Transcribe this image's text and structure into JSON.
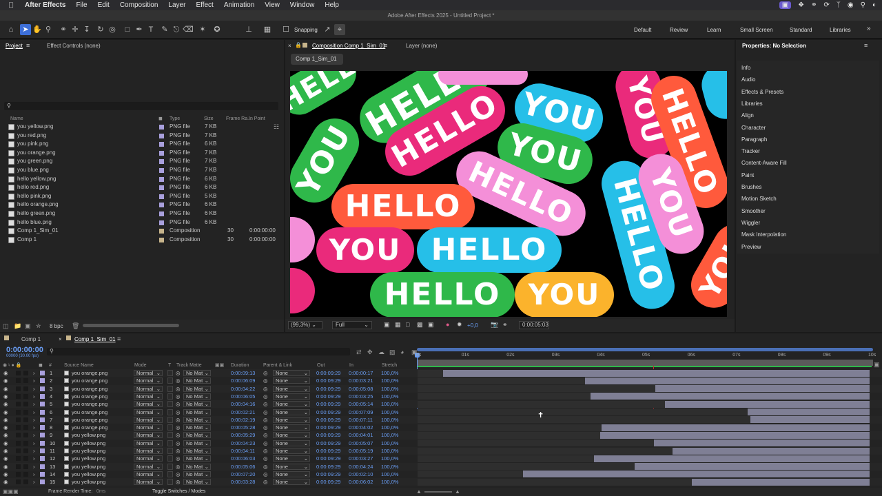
{
  "menubar": {
    "app": "After Effects",
    "items": [
      "File",
      "Edit",
      "Composition",
      "Layer",
      "Effect",
      "Animation",
      "View",
      "Window",
      "Help"
    ]
  },
  "window_title": "Adobe After Effects 2025 - Untitled Project *",
  "toolbar": {
    "snapping_label": "Snapping",
    "workspaces": [
      "Default",
      "Review",
      "Learn",
      "Small Screen",
      "Standard",
      "Libraries"
    ]
  },
  "project_panel": {
    "tab_project": "Project",
    "tab_effect_controls": "Effect Controls (none)",
    "columns": {
      "name": "Name",
      "type": "Type",
      "size": "Size",
      "frame_rate": "Frame Ra...",
      "in_point": "In Point"
    },
    "items": [
      {
        "name": "you yellow.png",
        "type": "PNG file",
        "size": "7 KB",
        "fr": "",
        "ip": ""
      },
      {
        "name": "you red.png",
        "type": "PNG file",
        "size": "7 KB",
        "fr": "",
        "ip": ""
      },
      {
        "name": "you pink.png",
        "type": "PNG file",
        "size": "6 KB",
        "fr": "",
        "ip": ""
      },
      {
        "name": "you orange.png",
        "type": "PNG file",
        "size": "7 KB",
        "fr": "",
        "ip": ""
      },
      {
        "name": "you green.png",
        "type": "PNG file",
        "size": "7 KB",
        "fr": "",
        "ip": ""
      },
      {
        "name": "you blue.png",
        "type": "PNG file",
        "size": "7 KB",
        "fr": "",
        "ip": ""
      },
      {
        "name": "hello yellow.png",
        "type": "PNG file",
        "size": "6 KB",
        "fr": "",
        "ip": ""
      },
      {
        "name": "hello red.png",
        "type": "PNG file",
        "size": "6 KB",
        "fr": "",
        "ip": ""
      },
      {
        "name": "hello pink.png",
        "type": "PNG file",
        "size": "5 KB",
        "fr": "",
        "ip": ""
      },
      {
        "name": "hello orange.png",
        "type": "PNG file",
        "size": "6 KB",
        "fr": "",
        "ip": ""
      },
      {
        "name": "hello green.png",
        "type": "PNG file",
        "size": "6 KB",
        "fr": "",
        "ip": ""
      },
      {
        "name": "hello blue.png",
        "type": "PNG file",
        "size": "6 KB",
        "fr": "",
        "ip": ""
      },
      {
        "name": "Comp 1_Sim_01",
        "type": "Composition",
        "size": "",
        "fr": "30",
        "ip": "0:00:00:00"
      },
      {
        "name": "Comp 1",
        "type": "Composition",
        "size": "",
        "fr": "30",
        "ip": "0:00:00:00"
      }
    ],
    "bpc": "8 bpc"
  },
  "composition_panel": {
    "tab_comp": "Composition Comp 1_Sim_01",
    "tab_layer": "Layer (none)",
    "breadcrumb": "Comp 1_Sim_01",
    "zoom": "(99,3%)",
    "resolution": "Full",
    "exposure": "+0,0",
    "timecode": "0:00:05:03",
    "words": {
      "hello": "HELLO",
      "you": "YOU"
    }
  },
  "properties_panel": {
    "title": "Properties: No Selection",
    "items": [
      "Info",
      "Audio",
      "Effects & Presets",
      "Libraries",
      "Align",
      "Character",
      "Paragraph",
      "Tracker",
      "Content-Aware Fill",
      "Paint",
      "Brushes",
      "Motion Sketch",
      "Smoother",
      "Wiggler",
      "Mask Interpolation",
      "Preview"
    ]
  },
  "timeline": {
    "tab1": "Comp 1",
    "tab2": "Comp 1_Sim_01",
    "current_time": "0:00:00:00",
    "frame_info": "00000 (30.00 fps)",
    "columns": {
      "num": "#",
      "source": "Source Name",
      "mode": "Mode",
      "t": "T",
      "track_matte": "Track Matte",
      "duration": "Duration",
      "parent": "Parent & Link",
      "out": "Out",
      "in": "In",
      "stretch": "Stretch"
    },
    "ruler": [
      "0s",
      "01s",
      "02s",
      "03s",
      "04s",
      "05s",
      "06s",
      "07s",
      "08s",
      "09s",
      "10s"
    ],
    "layers": [
      {
        "n": "1",
        "name": "you orange.png",
        "mode": "Normal",
        "matte": "No Mat",
        "dur": "0:00:09:13",
        "parent": "None",
        "out": "0:00:09:29",
        "in": "0:00:00:17",
        "str": "100,0%"
      },
      {
        "n": "2",
        "name": "you orange.png",
        "mode": "Normal",
        "matte": "No Mat",
        "dur": "0:00:06:09",
        "parent": "None",
        "out": "0:00:09:29",
        "in": "0:00:03:21",
        "str": "100,0%"
      },
      {
        "n": "3",
        "name": "you orange.png",
        "mode": "Normal",
        "matte": "No Mat",
        "dur": "0:00:04:22",
        "parent": "None",
        "out": "0:00:09:29",
        "in": "0:00:05:08",
        "str": "100,0%"
      },
      {
        "n": "4",
        "name": "you orange.png",
        "mode": "Normal",
        "matte": "No Mat",
        "dur": "0:00:06:05",
        "parent": "None",
        "out": "0:00:09:29",
        "in": "0:00:03:25",
        "str": "100,0%"
      },
      {
        "n": "5",
        "name": "you orange.png",
        "mode": "Normal",
        "matte": "No Mat",
        "dur": "0:00:04:16",
        "parent": "None",
        "out": "0:00:09:29",
        "in": "0:00:05:14",
        "str": "100,0%"
      },
      {
        "n": "6",
        "name": "you orange.png",
        "mode": "Normal",
        "matte": "No Mat",
        "dur": "0:00:02:21",
        "parent": "None",
        "out": "0:00:09:29",
        "in": "0:00:07:09",
        "str": "100,0%"
      },
      {
        "n": "7",
        "name": "you orange.png",
        "mode": "Normal",
        "matte": "No Mat",
        "dur": "0:00:02:19",
        "parent": "None",
        "out": "0:00:09:29",
        "in": "0:00:07:11",
        "str": "100,0%"
      },
      {
        "n": "8",
        "name": "you orange.png",
        "mode": "Normal",
        "matte": "No Mat",
        "dur": "0:00:05:28",
        "parent": "None",
        "out": "0:00:09:29",
        "in": "0:00:04:02",
        "str": "100,0%"
      },
      {
        "n": "9",
        "name": "you yellow.png",
        "mode": "Normal",
        "matte": "No Mat",
        "dur": "0:00:05:29",
        "parent": "None",
        "out": "0:00:09:29",
        "in": "0:00:04:01",
        "str": "100,0%"
      },
      {
        "n": "10",
        "name": "you yellow.png",
        "mode": "Normal",
        "matte": "No Mat",
        "dur": "0:00:04:23",
        "parent": "None",
        "out": "0:00:09:29",
        "in": "0:00:05:07",
        "str": "100,0%"
      },
      {
        "n": "11",
        "name": "you yellow.png",
        "mode": "Normal",
        "matte": "No Mat",
        "dur": "0:00:04:11",
        "parent": "None",
        "out": "0:00:09:29",
        "in": "0:00:05:19",
        "str": "100,0%"
      },
      {
        "n": "12",
        "name": "you yellow.png",
        "mode": "Normal",
        "matte": "No Mat",
        "dur": "0:00:06:03",
        "parent": "None",
        "out": "0:00:09:29",
        "in": "0:00:03:27",
        "str": "100,0%"
      },
      {
        "n": "13",
        "name": "you yellow.png",
        "mode": "Normal",
        "matte": "No Mat",
        "dur": "0:00:05:06",
        "parent": "None",
        "out": "0:00:09:29",
        "in": "0:00:04:24",
        "str": "100,0%"
      },
      {
        "n": "14",
        "name": "you yellow.png",
        "mode": "Normal",
        "matte": "No Mat",
        "dur": "0:00:07:20",
        "parent": "None",
        "out": "0:00:09:29",
        "in": "0:00:02:10",
        "str": "100,0%"
      },
      {
        "n": "15",
        "name": "you yellow.png",
        "mode": "Normal",
        "matte": "No Mat",
        "dur": "0:00:03:28",
        "parent": "None",
        "out": "0:00:09:29",
        "in": "0:00:06:02",
        "str": "100,0%"
      }
    ],
    "footer_render": "Frame Render Time:",
    "footer_render_value": "0ms",
    "footer_toggle": "Toggle Switches / Modes"
  }
}
